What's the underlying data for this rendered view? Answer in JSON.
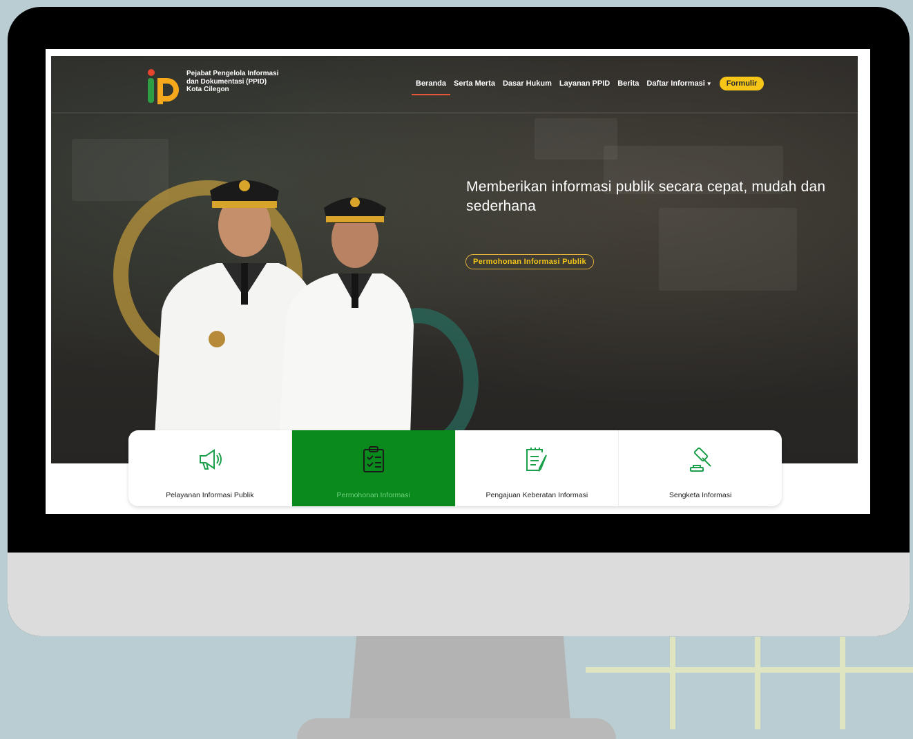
{
  "brand": {
    "line1": "Pejabat Pengelola Informasi",
    "line2": "dan Dokumentasi (PPID)",
    "line3": "Kota Cilegon"
  },
  "nav": {
    "items": [
      {
        "label": "Beranda",
        "active": true
      },
      {
        "label": "Serta Merta"
      },
      {
        "label": "Dasar Hukum"
      },
      {
        "label": "Layanan PPID"
      },
      {
        "label": "Berita"
      },
      {
        "label": "Daftar Informasi"
      }
    ],
    "formulir": "Formulir"
  },
  "hero": {
    "tagline": "Memberikan informasi publik secara cepat, mudah dan sederhana",
    "cta": "Permohonan Informasi Publik"
  },
  "cards": [
    {
      "label": "Pelayanan Informasi Publik",
      "icon": "megaphone-icon"
    },
    {
      "label": "Permohonan Informasi",
      "icon": "clipboard-list-icon",
      "active": true
    },
    {
      "label": "Pengajuan Keberatan Informasi",
      "icon": "document-edit-icon"
    },
    {
      "label": "Sengketa Informasi",
      "icon": "gavel-icon"
    }
  ],
  "colors": {
    "accent_yellow": "#f5c518",
    "active_green": "#0a8a1c",
    "nav_underline": "#e5553a"
  }
}
